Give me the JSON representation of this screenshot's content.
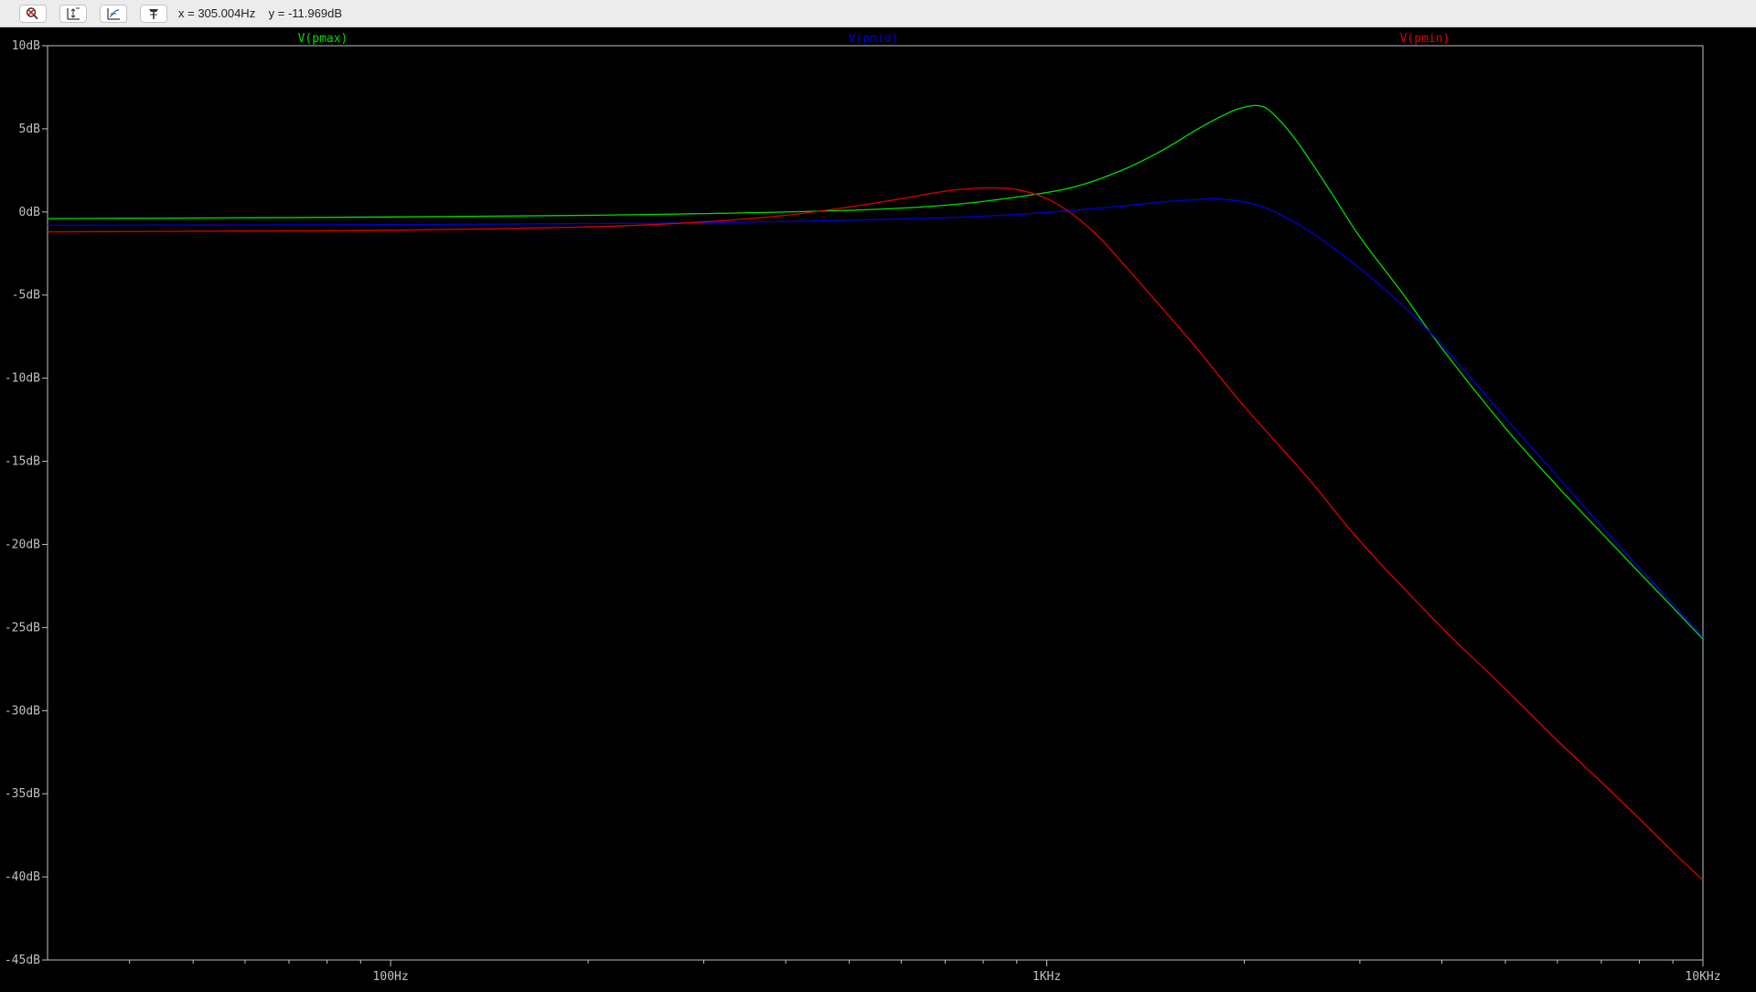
{
  "toolbar": {
    "buttons": [
      {
        "name": "zoom-cancel",
        "icon": "zoom-cancel-icon"
      },
      {
        "name": "autorange-y",
        "icon": "autorange-y-icon"
      },
      {
        "name": "autorange-x",
        "icon": "autorange-x-icon"
      },
      {
        "name": "probe",
        "icon": "probe-icon"
      }
    ],
    "cursor_readout": "x = 305.004Hz    y = -11.969dB"
  },
  "colors": {
    "background": "#000000",
    "axis": "#c0c0c0",
    "pmax": "#00dd00",
    "pmid": "#0000dd",
    "pmin": "#dd0000"
  },
  "chart_data": {
    "type": "line",
    "title": "",
    "xscale": "log",
    "xlim": [
      30,
      10000
    ],
    "ylim": [
      -45,
      10
    ],
    "xticks": [
      100,
      1000,
      10000
    ],
    "xtick_labels": [
      "100Hz",
      "1KHz",
      "10KHz"
    ],
    "yticks": [
      10,
      5,
      0,
      -5,
      -10,
      -15,
      -20,
      -25,
      -30,
      -35,
      -40,
      -45
    ],
    "ytick_labels": [
      "10dB",
      "5dB",
      "0dB",
      "-5dB",
      "-10dB",
      "-15dB",
      "-20dB",
      "-25dB",
      "-30dB",
      "-35dB",
      "-40dB",
      "-45dB"
    ],
    "grid": false,
    "legend_placement": "top",
    "series": [
      {
        "name": "V(pmax)",
        "color": "#00dd00",
        "x": [
          30,
          60,
          100,
          200,
          300,
          500,
          700,
          900,
          1100,
          1300,
          1500,
          1700,
          1900,
          2000,
          2100,
          2200,
          2400,
          2700,
          3000,
          3500,
          4000,
          5000,
          6000,
          7000,
          8000,
          9000,
          10000
        ],
        "y": [
          -0.4,
          -0.35,
          -0.3,
          -0.2,
          -0.1,
          0.1,
          0.4,
          0.9,
          1.5,
          2.5,
          3.7,
          5.0,
          6.0,
          6.3,
          6.4,
          6.0,
          4.3,
          1.3,
          -1.5,
          -5.0,
          -8.2,
          -13.0,
          -16.5,
          -19.3,
          -21.7,
          -23.8,
          -25.7
        ]
      },
      {
        "name": "V(pmid)",
        "color": "#0000dd",
        "x": [
          30,
          60,
          100,
          200,
          300,
          500,
          700,
          900,
          1100,
          1300,
          1500,
          1700,
          1800,
          2000,
          2200,
          2500,
          3000,
          3500,
          4000,
          5000,
          6000,
          7000,
          8000,
          9000,
          10000
        ],
        "y": [
          -0.8,
          -0.78,
          -0.76,
          -0.7,
          -0.65,
          -0.5,
          -0.35,
          -0.15,
          0.1,
          0.35,
          0.6,
          0.75,
          0.8,
          0.6,
          0.1,
          -1.1,
          -3.4,
          -5.7,
          -8.0,
          -12.4,
          -15.9,
          -18.9,
          -21.4,
          -23.6,
          -25.6
        ]
      },
      {
        "name": "V(pmin)",
        "color": "#dd0000",
        "x": [
          30,
          60,
          100,
          200,
          300,
          400,
          500,
          600,
          700,
          800,
          900,
          1000,
          1100,
          1200,
          1300,
          1500,
          1700,
          2000,
          2500,
          3000,
          4000,
          5000,
          6000,
          7000,
          8000,
          9000,
          10000
        ],
        "y": [
          -1.2,
          -1.15,
          -1.1,
          -0.9,
          -0.6,
          -0.2,
          0.3,
          0.8,
          1.25,
          1.45,
          1.35,
          0.8,
          -0.2,
          -1.5,
          -3.0,
          -5.8,
          -8.3,
          -11.7,
          -16.0,
          -19.8,
          -25.0,
          -28.7,
          -31.8,
          -34.3,
          -36.5,
          -38.5,
          -40.2
        ]
      }
    ]
  }
}
